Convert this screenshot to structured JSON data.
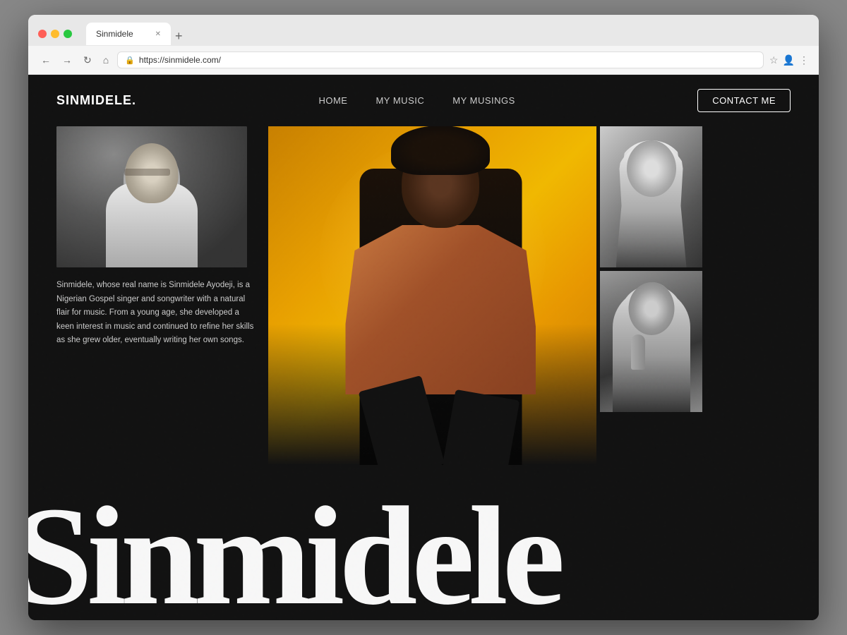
{
  "browser": {
    "tab_title": "Sinmidele",
    "url": "https://sinmidele.com/",
    "nav_back": "←",
    "nav_forward": "→",
    "nav_refresh": "↻",
    "nav_home": "⌂",
    "new_tab_label": "+"
  },
  "nav": {
    "logo": "SINMIDELE.",
    "links": [
      {
        "label": "HOME",
        "id": "home"
      },
      {
        "label": "MY MUSIC",
        "id": "my-music"
      },
      {
        "label": "MY MUSINGS",
        "id": "my-musings"
      }
    ],
    "contact_button": "CONTACT ME"
  },
  "hero": {
    "bio_text": "Sinmidele, whose real name is Sinmidele Ayodeji, is a Nigerian Gospel singer and songwriter with a natural flair for music. From a young age, she developed a keen interest in music and continued to refine her skills as she grew older, eventually writing her own songs.",
    "big_name": "Sinmidele"
  },
  "photos": {
    "portrait_alt": "Sinmidele portrait black and white",
    "main_alt": "Sinmidele seated against golden background",
    "right1_alt": "Sinmidele performing black and white",
    "right2_alt": "Sinmidele with microphone black and white"
  }
}
